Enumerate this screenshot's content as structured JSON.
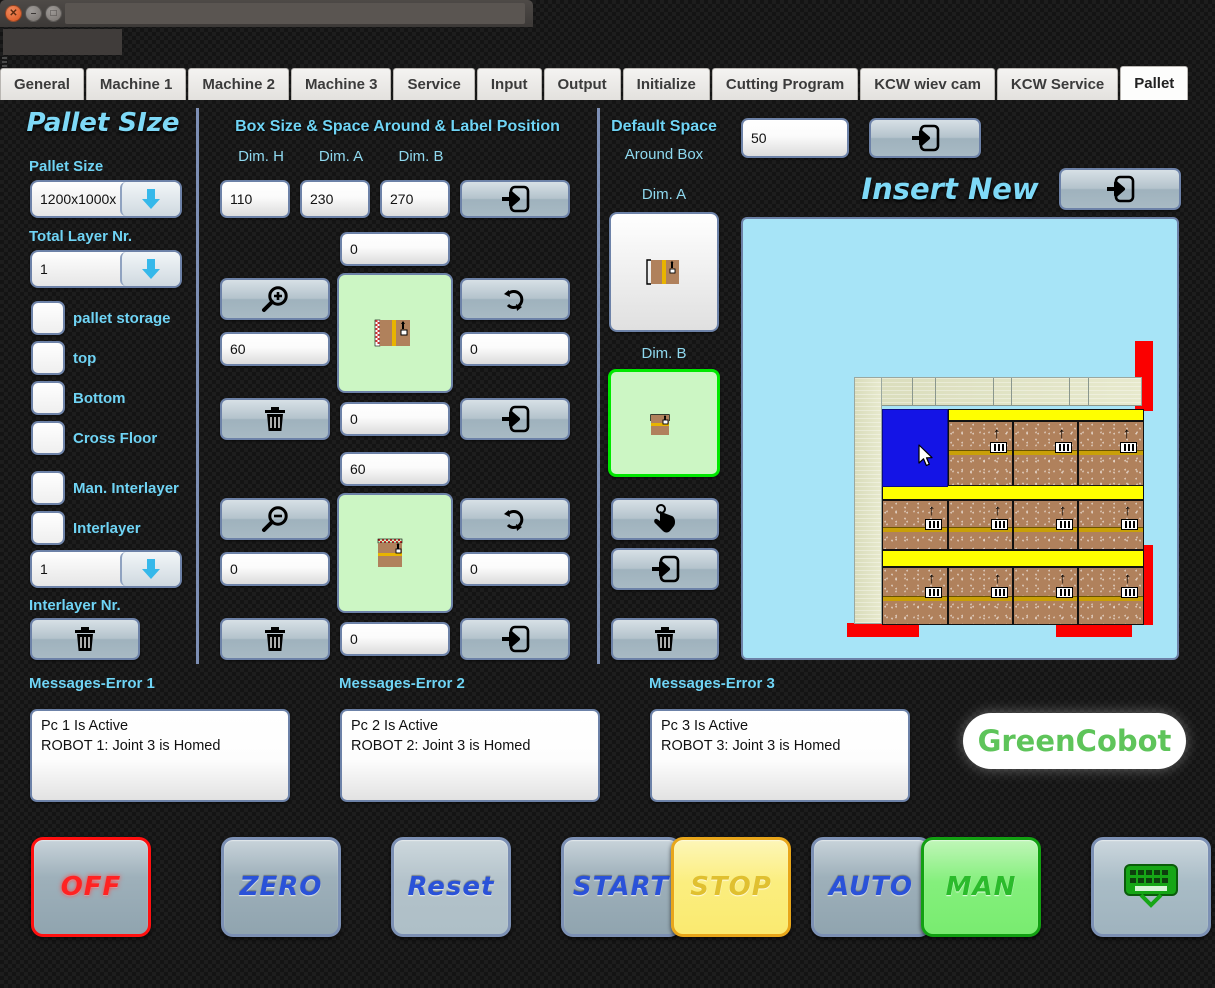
{
  "window": {
    "buttons": [
      "close-button",
      "minimize-button",
      "maximize-button"
    ],
    "title": ""
  },
  "tabs": [
    {
      "label": "General",
      "active": false
    },
    {
      "label": "Machine 1",
      "active": false
    },
    {
      "label": "Machine 2",
      "active": false
    },
    {
      "label": "Machine 3",
      "active": false
    },
    {
      "label": "Service",
      "active": false
    },
    {
      "label": "Input",
      "active": false
    },
    {
      "label": "Output",
      "active": false
    },
    {
      "label": "Initialize",
      "active": false
    },
    {
      "label": "Cutting Program",
      "active": false
    },
    {
      "label": "KCW wiev cam",
      "active": false
    },
    {
      "label": "KCW Service",
      "active": false
    },
    {
      "label": "Pallet",
      "active": true
    }
  ],
  "pallet_panel": {
    "title": "Pallet SIze",
    "pallet_size_label": "Pallet Size",
    "pallet_size_value": "1200x1000x",
    "total_layer_label": "Total Layer Nr.",
    "total_layer_value": "1",
    "checkboxes": [
      {
        "label": "pallet storage",
        "checked": false
      },
      {
        "label": "top",
        "checked": false
      },
      {
        "label": "Bottom",
        "checked": false
      },
      {
        "label": "Cross Floor",
        "checked": false
      },
      {
        "label": "Man. Interlayer",
        "checked": false
      },
      {
        "label": "Interlayer",
        "checked": false
      }
    ],
    "interlayer_count_value": "1",
    "interlayer_nr_label": "Interlayer Nr.",
    "delete_icon": "trash-icon"
  },
  "box_panel": {
    "title": "Box Size & Space Around & Label Position",
    "dim_h_label": "Dim. H",
    "dim_a_label": "Dim. A",
    "dim_b_label": "Dim. B",
    "dim_h_value": "110",
    "dim_a_value": "230",
    "dim_b_value": "270",
    "apply_top_icon": "import-arrow-icon",
    "row1": {
      "top_value": "0",
      "left_icon": "zoom-in-icon",
      "left_value": "60",
      "right_icon": "rotate-icon",
      "right_value": "0",
      "bottom_left_icon": "trash-icon",
      "bottom_value": "0",
      "bottom_right_icon": "import-arrow-icon",
      "preview": "box-side-view"
    },
    "row2": {
      "top_value": "60",
      "left_icon": "zoom-out-icon",
      "left_value": "0",
      "right_icon": "rotate-icon",
      "right_value": "0",
      "bottom_left_icon": "trash-icon",
      "bottom_value": "0",
      "bottom_right_icon": "import-arrow-icon",
      "preview": "box-top-view"
    }
  },
  "default_space": {
    "title_line1": "Default Space",
    "title_line2": "Around Box",
    "value": "50",
    "apply_icon": "import-arrow-icon",
    "dim_a_label": "Dim. A",
    "dim_b_label": "Dim. B",
    "dim_a_selected": false,
    "dim_b_selected": true,
    "buttons": [
      {
        "icon": "hand-pointer-icon"
      },
      {
        "icon": "import-arrow-icon"
      },
      {
        "icon": "trash-icon"
      }
    ]
  },
  "insert_new": {
    "title": "Insert New",
    "apply_icon": "import-arrow-icon"
  },
  "pallet_view": {
    "background_color": "#a7e4f7",
    "pallet_color": "#e0e3c5",
    "box_color": "#b0815c",
    "highlight_color": "#1414e6",
    "divider_color": "#ffff00",
    "marker_color": "#fb0000",
    "selected_box_index": 0,
    "cursor": "arrow-cursor"
  },
  "messages": [
    {
      "title": "Messages-Error 1",
      "text": "Pc 1 Is Active\nROBOT 1: Joint 3 is Homed"
    },
    {
      "title": "Messages-Error 2",
      "text": "Pc 2 Is Active\nROBOT 2: Joint 3 is Homed"
    },
    {
      "title": "Messages-Error 3",
      "text": "Pc 3 Is Active\nROBOT 3: Joint 3 is Homed"
    }
  ],
  "brand": {
    "name": "GreenCobot",
    "color": "#5ec45a"
  },
  "control_buttons": [
    {
      "label": "OFF",
      "state": "off"
    },
    {
      "label": "ZERO",
      "state": "normal"
    },
    {
      "label": "Reset",
      "state": "reset"
    },
    {
      "label": "START",
      "state": "normal"
    },
    {
      "label": "STOP",
      "state": "stop"
    },
    {
      "label": "AUTO",
      "state": "normal"
    },
    {
      "label": "MAN",
      "state": "man"
    },
    {
      "label": "",
      "state": "keyboard",
      "icon": "keyboard-icon"
    }
  ]
}
